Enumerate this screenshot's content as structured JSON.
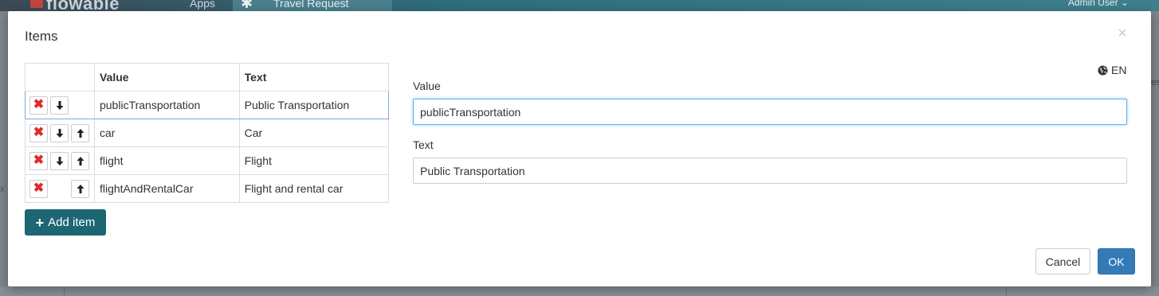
{
  "app": {
    "logo_text": "flowable",
    "nav_apps": "Apps",
    "nav_travel": "Travel Request",
    "user_menu": "Admin User"
  },
  "background": {
    "left_fragment": "x",
    "right_fragment": "es"
  },
  "modal": {
    "title": "Items",
    "close_symbol": "×",
    "table": {
      "headers": [
        "",
        "Value",
        "Text"
      ],
      "rows": [
        {
          "value": "publicTransportation",
          "text": "Public Transportation",
          "selected": true,
          "can_remove": true,
          "can_move_down": true,
          "can_move_up": false
        },
        {
          "value": "car",
          "text": "Car",
          "selected": false,
          "can_remove": true,
          "can_move_down": true,
          "can_move_up": true
        },
        {
          "value": "flight",
          "text": "Flight",
          "selected": false,
          "can_remove": true,
          "can_move_down": true,
          "can_move_up": true
        },
        {
          "value": "flightAndRentalCar",
          "text": "Flight and rental car",
          "selected": false,
          "can_remove": true,
          "can_move_down": false,
          "can_move_up": true
        }
      ]
    },
    "add_item_label": "Add item",
    "language": "EN",
    "value_label": "Value",
    "value_input": "publicTransportation",
    "text_label": "Text",
    "text_input": "Public Transportation",
    "cancel_label": "Cancel",
    "ok_label": "OK"
  },
  "colors": {
    "primary": "#337ab7",
    "add_button": "#1d6673",
    "remove_icon": "#e02a2a",
    "selection_border": "#7ea7de"
  }
}
